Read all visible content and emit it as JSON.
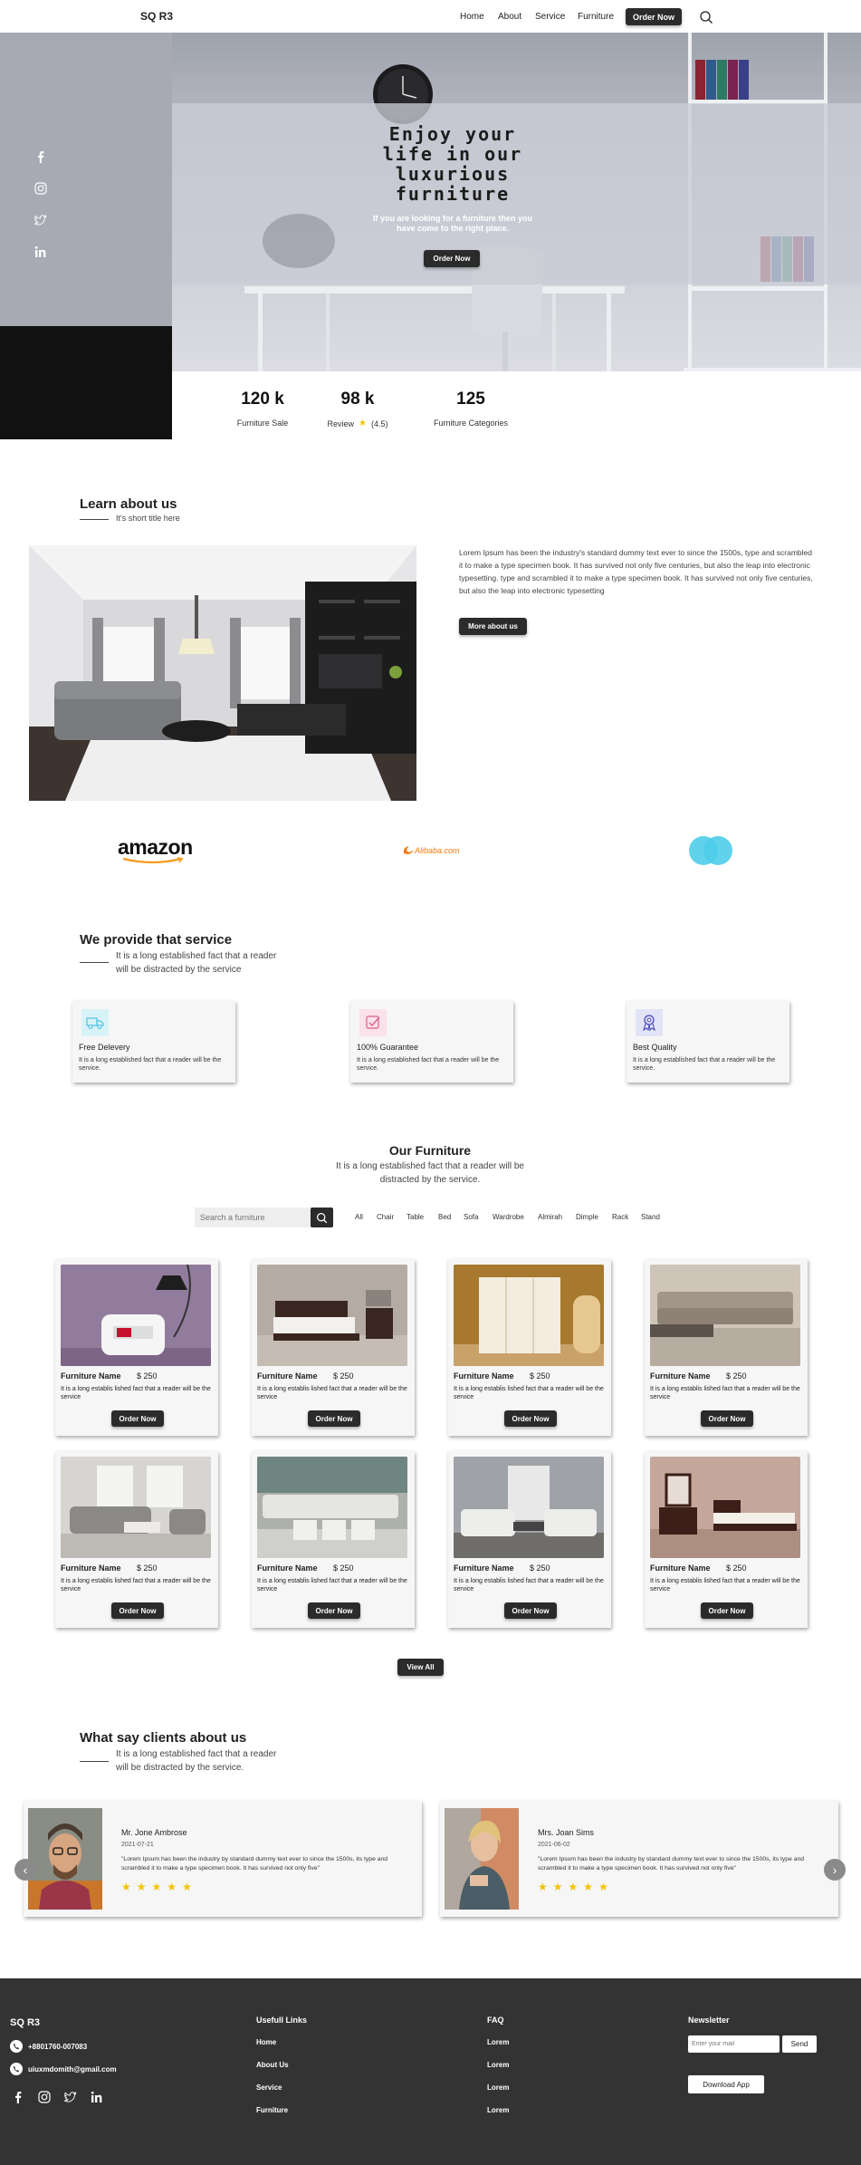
{
  "brand": "SQ R3",
  "nav": {
    "home": "Home",
    "about": "About",
    "service": "Service",
    "furniture": "Furniture",
    "order_now": "Order Now"
  },
  "hero": {
    "title_line1": "Enjoy your",
    "title_line2": "life in our",
    "title_line3": "luxurious",
    "title_line4": "furniture",
    "subtitle_line1": "If you are looking for a furniture then you",
    "subtitle_line2": "have come to the right place.",
    "button": "Order Now"
  },
  "social": [
    "facebook-icon",
    "instagram-icon",
    "twitter-icon",
    "linkedin-icon"
  ],
  "stats": [
    {
      "value": "120 k",
      "label": "Furniture Sale"
    },
    {
      "value": "98 k",
      "label": "Review",
      "rating": "(4.5)"
    },
    {
      "value": "125",
      "label": "Furniture Categories"
    }
  ],
  "about": {
    "title": "Learn about us",
    "subtitle": "It's short title here",
    "text": "Lorem Ipsum has been the industry's standard dummy text ever to since the 1500s, type and scrambled it to make a type specimen book. It has survived not only five centuries, but also the leap into electronic typesetting. type and scrambled it to make a type specimen book. It has survived not only five centuries, but also the leap into electronic typesetting",
    "button": "More about us"
  },
  "partners": {
    "amazon": "amazon",
    "alibaba": "Alibaba.com"
  },
  "services": {
    "title": "We provide that service",
    "subtitle_line1": "It is a long established fact that a reader",
    "subtitle_line2": "will be distracted by the service",
    "items": [
      {
        "icon": "truck-icon",
        "title": "Free Delevery",
        "desc": "It is a long established fact that a reader will be the service."
      },
      {
        "icon": "check-icon",
        "title": "100% Guarantee",
        "desc": "It is a long established fact that a reader will be the service."
      },
      {
        "icon": "award-icon",
        "title": "Best Quality",
        "desc": "It is a long established fact that a reader will be the service."
      }
    ]
  },
  "furniture": {
    "title": "Our Furniture",
    "subtitle_line1": "It is a long established fact that a reader will be",
    "subtitle_line2": "distracted by the service.",
    "search_placeholder": "Search a furniture",
    "filters": [
      "All",
      "Chair",
      "Table",
      "Bed",
      "Sofa",
      "Wardrobe",
      "Almirah",
      "Dimple",
      "Rack",
      "Stand"
    ],
    "items": [
      {
        "name": "Furniture Name",
        "price": "$ 250",
        "desc": "It is a long establis lished fact that a reader will be the service",
        "button": "Order Now"
      },
      {
        "name": "Furniture Name",
        "price": "$ 250",
        "desc": "It is a long establis lished fact that a reader will be the service",
        "button": "Order Now"
      },
      {
        "name": "Furniture Name",
        "price": "$ 250",
        "desc": "It is a long establis lished fact that a reader will be the service",
        "button": "Order Now"
      },
      {
        "name": "Furniture Name",
        "price": "$ 250",
        "desc": "It is a long establis lished fact that a reader will be the service",
        "button": "Order Now"
      },
      {
        "name": "Furniture Name",
        "price": "$ 250",
        "desc": "It is a long establis lished fact that a reader will be the service",
        "button": "Order Now"
      },
      {
        "name": "Furniture Name",
        "price": "$ 250",
        "desc": "It is a long establis lished fact that a reader will be the service",
        "button": "Order Now"
      },
      {
        "name": "Furniture Name",
        "price": "$ 250",
        "desc": "It is a long establis lished fact that a reader will be the service",
        "button": "Order Now"
      },
      {
        "name": "Furniture Name",
        "price": "$ 250",
        "desc": "It is a long establis lished fact that a reader will be the service",
        "button": "Order Now"
      }
    ],
    "view_all": "View All"
  },
  "testimonials": {
    "title": "What say clients about us",
    "subtitle_line1": "It is a long established fact that a reader",
    "subtitle_line2": "will be distracted by the service.",
    "items": [
      {
        "name": "Mr. Jone Ambrose",
        "date": "2021-07-21",
        "quote": "\"Lorem Ipsum has been the industry by standard dummy text ever to since the 1500s, its type and scrambled it to make a type specimen book. It has survived not only five\"",
        "stars": 5
      },
      {
        "name": "Mrs. Joan Sims",
        "date": "2021-06-02",
        "quote": "\"Lorem Ipsum has been the industry by standard dummy text ever to since the 1500s, its type and scrambled it to make a type specimen book. It has survived not only five\"",
        "stars": 5
      }
    ],
    "prev": "‹",
    "next": "›"
  },
  "footer": {
    "brand": "SQ R3",
    "phone": "+8801760-007083",
    "email": "uiuxmdomith@gmail.com",
    "links_title": "Usefull Links",
    "links": [
      "Home",
      "About Us",
      "Service",
      "Furniture"
    ],
    "faq_title": "FAQ",
    "faq": [
      "Lorem",
      "Lorem",
      "Lorem",
      "Lorem"
    ],
    "newsletter_title": "Newsletter",
    "newsletter_placeholder": "Enter your mail",
    "send": "Send",
    "download": "Download App"
  },
  "colors": {
    "dark": "#2b2b2b",
    "footer_bg": "#333333",
    "star": "#f3c300",
    "hero_overlay": "#c5c8d2"
  }
}
